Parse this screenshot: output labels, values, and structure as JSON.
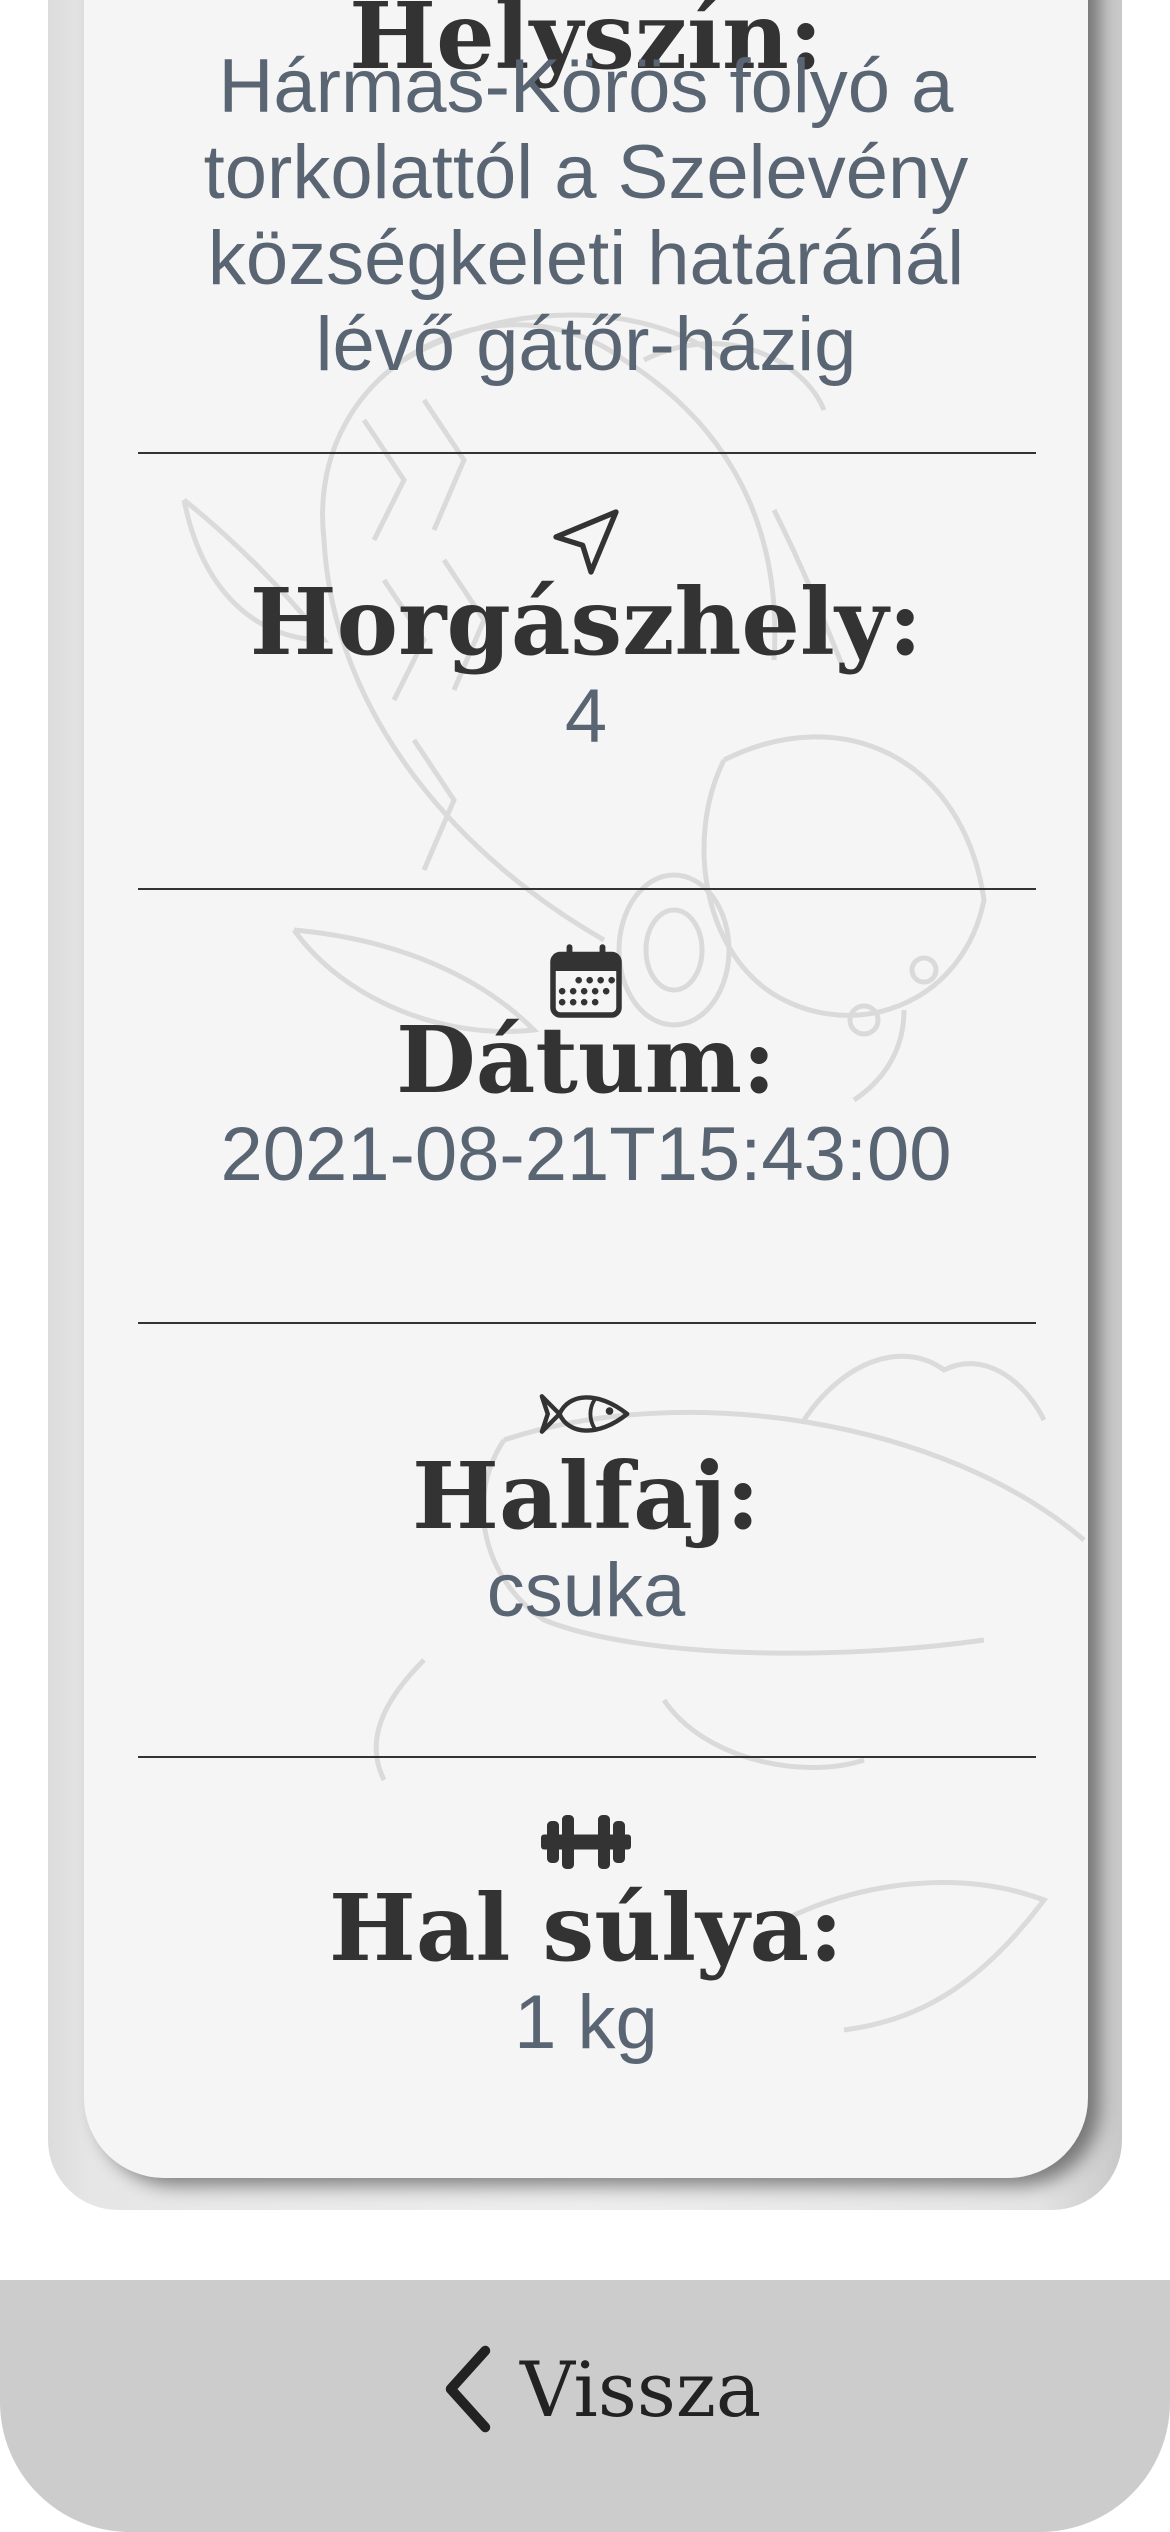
{
  "location": {
    "label": "Helyszín:",
    "value": "Hármas-Körös folyó a torkolattól a Szelevény községkeleti határánál lévő gátőr-házig",
    "value_lines": [
      "Hármas-Körös folyó a",
      "torkolattól a Szelevény",
      "községkeleti határánál",
      "lévő gátőr-házig"
    ]
  },
  "spot": {
    "icon": "navigation-arrow-icon",
    "label": "Horgászhely:",
    "value": "4"
  },
  "date": {
    "icon": "calendar-icon",
    "label": "Dátum:",
    "value": "2021-08-21T15:43:00"
  },
  "species": {
    "icon": "fish-icon",
    "label": "Halfaj:",
    "value": "csuka"
  },
  "weight": {
    "icon": "dumbbell-icon",
    "label": "Hal súlya:",
    "value": "1 kg"
  },
  "footer": {
    "back_icon": "chevron-left-icon",
    "back_label": "Vissza"
  },
  "colors": {
    "card_background": "#f5f5f5",
    "heading_text": "#333333",
    "value_text": "#5a6573",
    "footer_background": "#cccccc"
  }
}
